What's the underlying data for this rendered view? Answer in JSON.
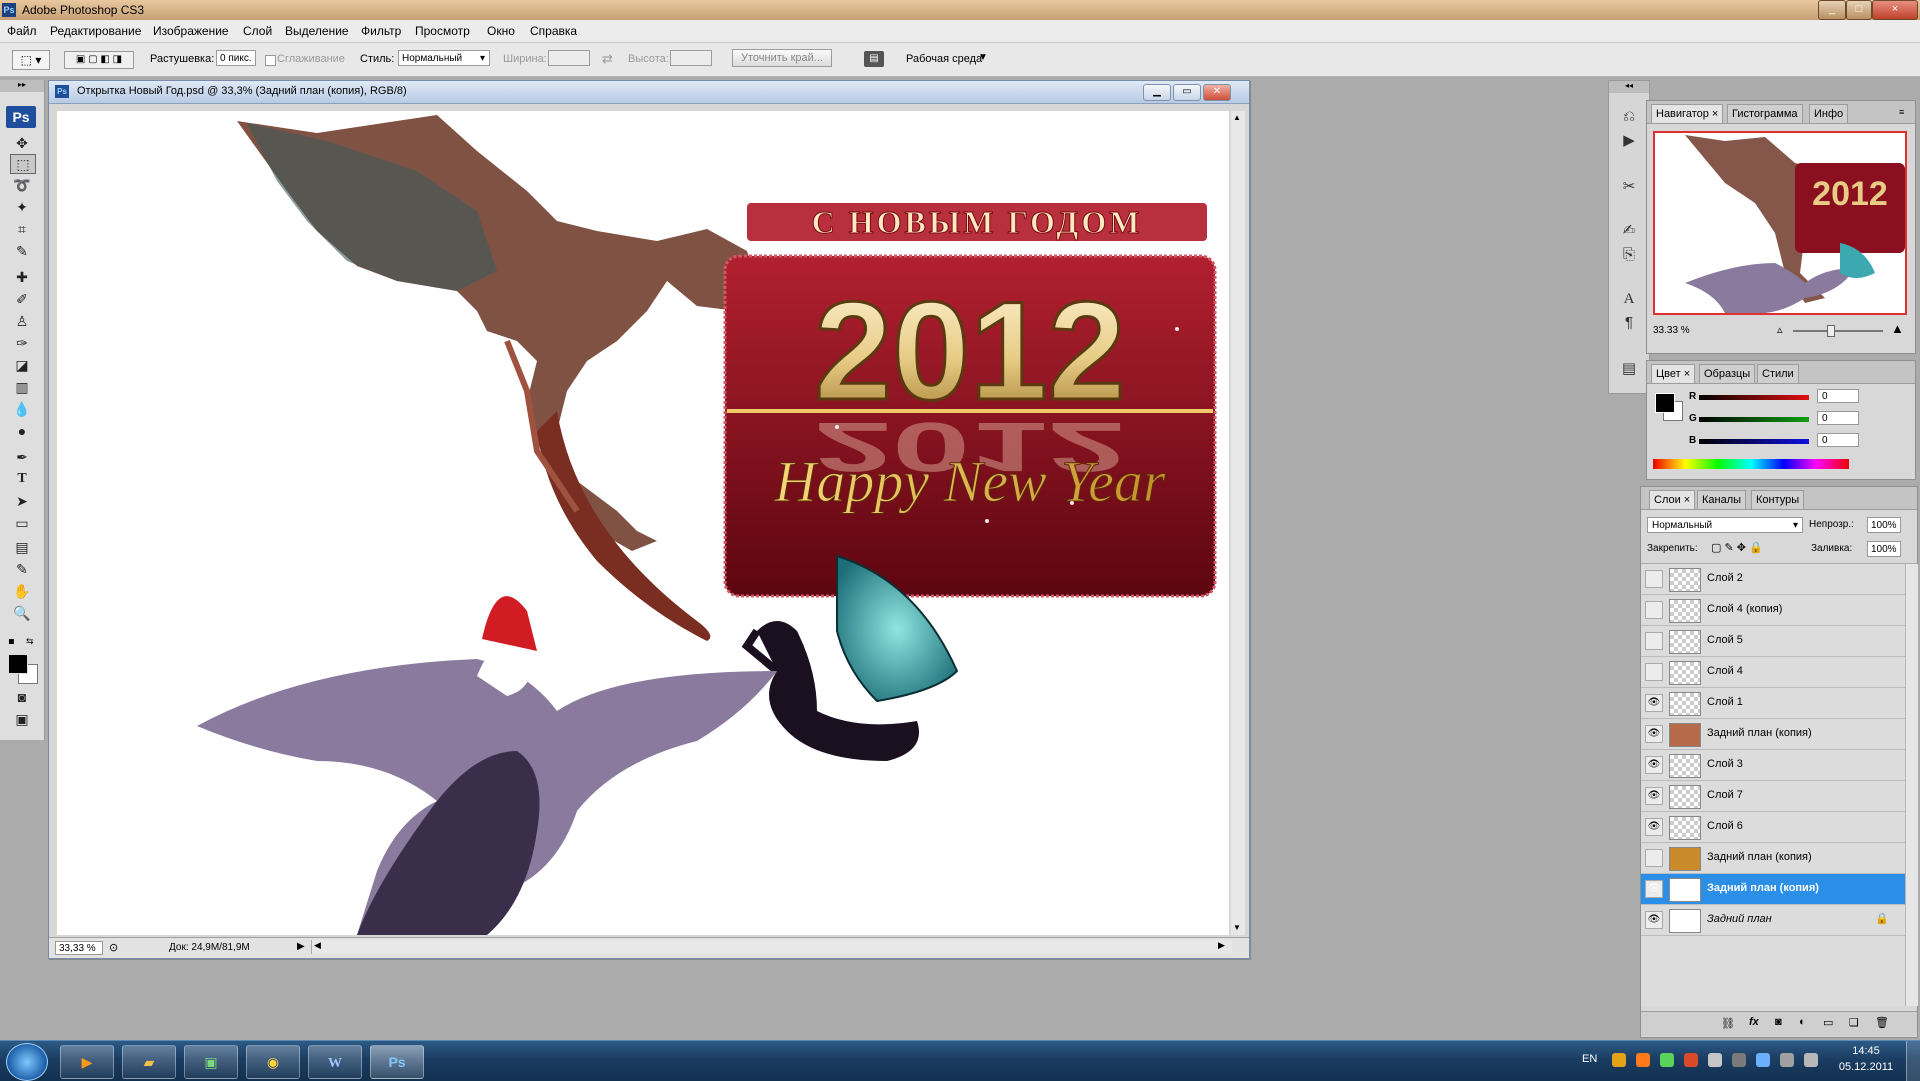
{
  "app": {
    "title": "Adobe Photoshop CS3",
    "window_controls": [
      "_",
      "□",
      "×"
    ]
  },
  "menu": [
    "Файл",
    "Редактирование",
    "Изображение",
    "Слой",
    "Выделение",
    "Фильтр",
    "Просмотр",
    "Окно",
    "Справка"
  ],
  "options": {
    "feather_label": "Растушевка:",
    "feather_value": "0 пикс.",
    "antialias_label": "Сглаживание",
    "style_label": "Стиль:",
    "style_value": "Нормальный",
    "width_label": "Ширина:",
    "height_label": "Высота:",
    "refine_edge_button": "Уточнить край...",
    "workspace_label": "Рабочая среда"
  },
  "document": {
    "title": "Открытка Новый Год.psd @ 33,3% (Задний план (копия), RGB/8)",
    "zoom": "33,33 %",
    "doc_size": "Док: 24,9M/81,9M"
  },
  "artwork": {
    "greeting": "С НОВЫМ ГОДОМ",
    "year": "2012",
    "tagline": "Happy New Year",
    "colors": {
      "banner": "#8a1020",
      "gold": "#e8cc86",
      "dragon_top": "#6e3a2a",
      "dragon_purple": "#8a7a9e",
      "dragon_teal": "#3ca9b0"
    }
  },
  "navigator": {
    "tabs": [
      "Навигатор",
      "Гистограмма",
      "Инфо"
    ],
    "zoom": "33.33 %",
    "preview_year": "2012"
  },
  "color_panel": {
    "tabs": [
      "Цвет",
      "Образцы",
      "Стили"
    ],
    "channels": [
      {
        "label": "R",
        "value": "0",
        "color": "#e01010"
      },
      {
        "label": "G",
        "value": "0",
        "color": "#10a010"
      },
      {
        "label": "B",
        "value": "0",
        "color": "#1010e0"
      }
    ]
  },
  "layers_panel": {
    "tabs": [
      "Слои",
      "Каналы",
      "Контуры"
    ],
    "blend_mode": "Нормальный",
    "opacity_label": "Непрозр.:",
    "opacity_value": "100%",
    "lock_label": "Закрепить:",
    "fill_label": "Заливка:",
    "fill_value": "100%",
    "layers": [
      {
        "name": "Слой 2",
        "visible": false,
        "selected": false
      },
      {
        "name": "Слой 4 (копия)",
        "visible": false,
        "selected": false
      },
      {
        "name": "Слой 5",
        "visible": false,
        "selected": false
      },
      {
        "name": "Слой 4",
        "visible": false,
        "selected": false
      },
      {
        "name": "Слой 1",
        "visible": true,
        "selected": false
      },
      {
        "name": "Задний план (копия)",
        "visible": true,
        "selected": false
      },
      {
        "name": "Слой 3",
        "visible": true,
        "selected": false
      },
      {
        "name": "Слой 7",
        "visible": true,
        "selected": false
      },
      {
        "name": "Слой 6",
        "visible": true,
        "selected": false
      },
      {
        "name": "Задний план (копия)",
        "visible": false,
        "selected": false
      },
      {
        "name": "Задний план (копия)",
        "visible": true,
        "selected": true
      },
      {
        "name": "Задний план",
        "visible": true,
        "selected": false
      }
    ]
  },
  "taskbar": {
    "lang": "EN",
    "time": "14:45",
    "date": "05.12.2011",
    "apps": [
      "start-orb",
      "media-player",
      "explorer",
      "task-manager",
      "chrome",
      "word",
      "photoshop"
    ],
    "photoshop_label": "Ps",
    "word_label": "W"
  },
  "tools": [
    "move-tool",
    "marquee-tool",
    "lasso-tool",
    "magic-wand-tool",
    "crop-tool",
    "eyedropper-tool",
    "healing-brush-tool",
    "brush-tool",
    "clone-stamp-tool",
    "history-brush-tool",
    "eraser-tool",
    "gradient-tool",
    "blur-tool",
    "dodge-tool",
    "pen-tool",
    "type-tool",
    "path-selection-tool",
    "shape-tool",
    "notes-tool",
    "eyedropper2-tool",
    "hand-tool",
    "zoom-tool"
  ],
  "tool_logo": "Ps"
}
